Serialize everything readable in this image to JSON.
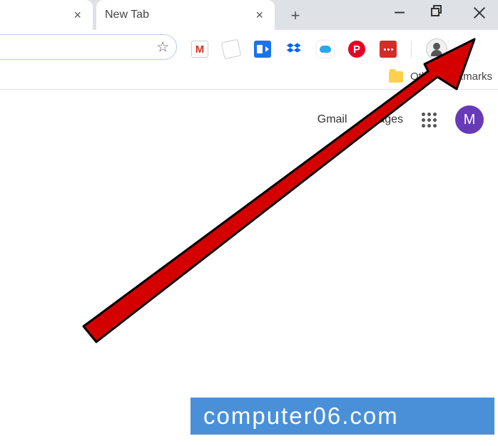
{
  "tabs": [
    {
      "title": "",
      "close": "×"
    },
    {
      "title": "New Tab",
      "close": "×"
    }
  ],
  "newtab_glyph": "+",
  "window_controls": {
    "minimize": "−",
    "maximize": "❐",
    "close": "×"
  },
  "omnibox": {
    "value": "",
    "star_glyph": "☆"
  },
  "extensions": [
    {
      "name": "gmail"
    },
    {
      "name": "tag"
    },
    {
      "name": "blue-badge"
    },
    {
      "name": "dropbox",
      "glyph": "⯁"
    },
    {
      "name": "onedrive"
    },
    {
      "name": "pinterest"
    },
    {
      "name": "lastpass"
    }
  ],
  "bookmarks": {
    "other_label": "Other bookmarks"
  },
  "ntp": {
    "gmail": "Gmail",
    "images": "Images",
    "avatar_initial": "M"
  },
  "watermark": "computer06.com"
}
